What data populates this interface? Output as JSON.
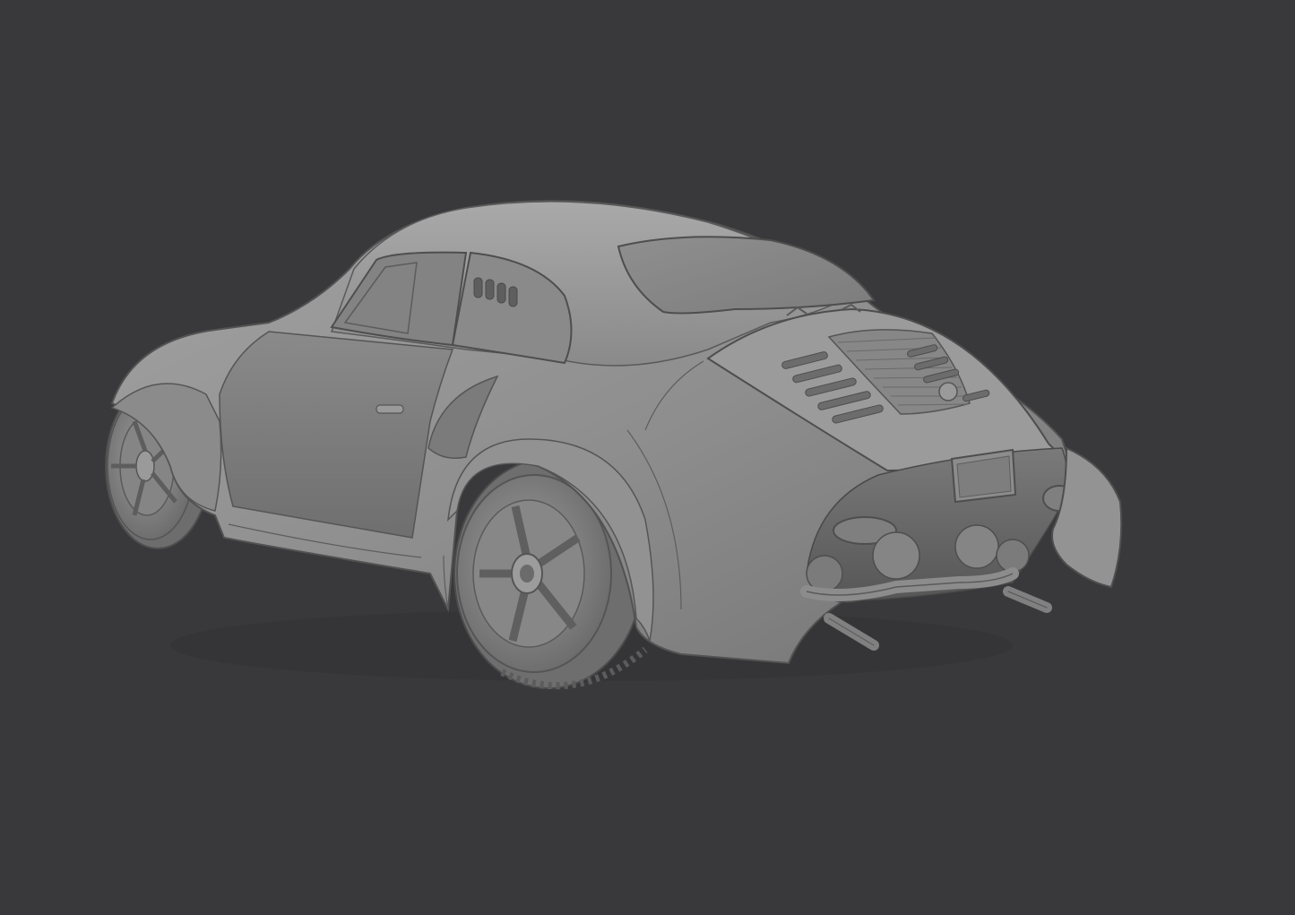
{
  "viewport": {
    "background": "#39393b",
    "model_color": "#8e8e8e",
    "model_light": "#a8a8a8",
    "model_dark": "#5e5e5e",
    "edge_color": "#4a4a4a"
  },
  "object": {
    "icon": "car-model-icon"
  }
}
